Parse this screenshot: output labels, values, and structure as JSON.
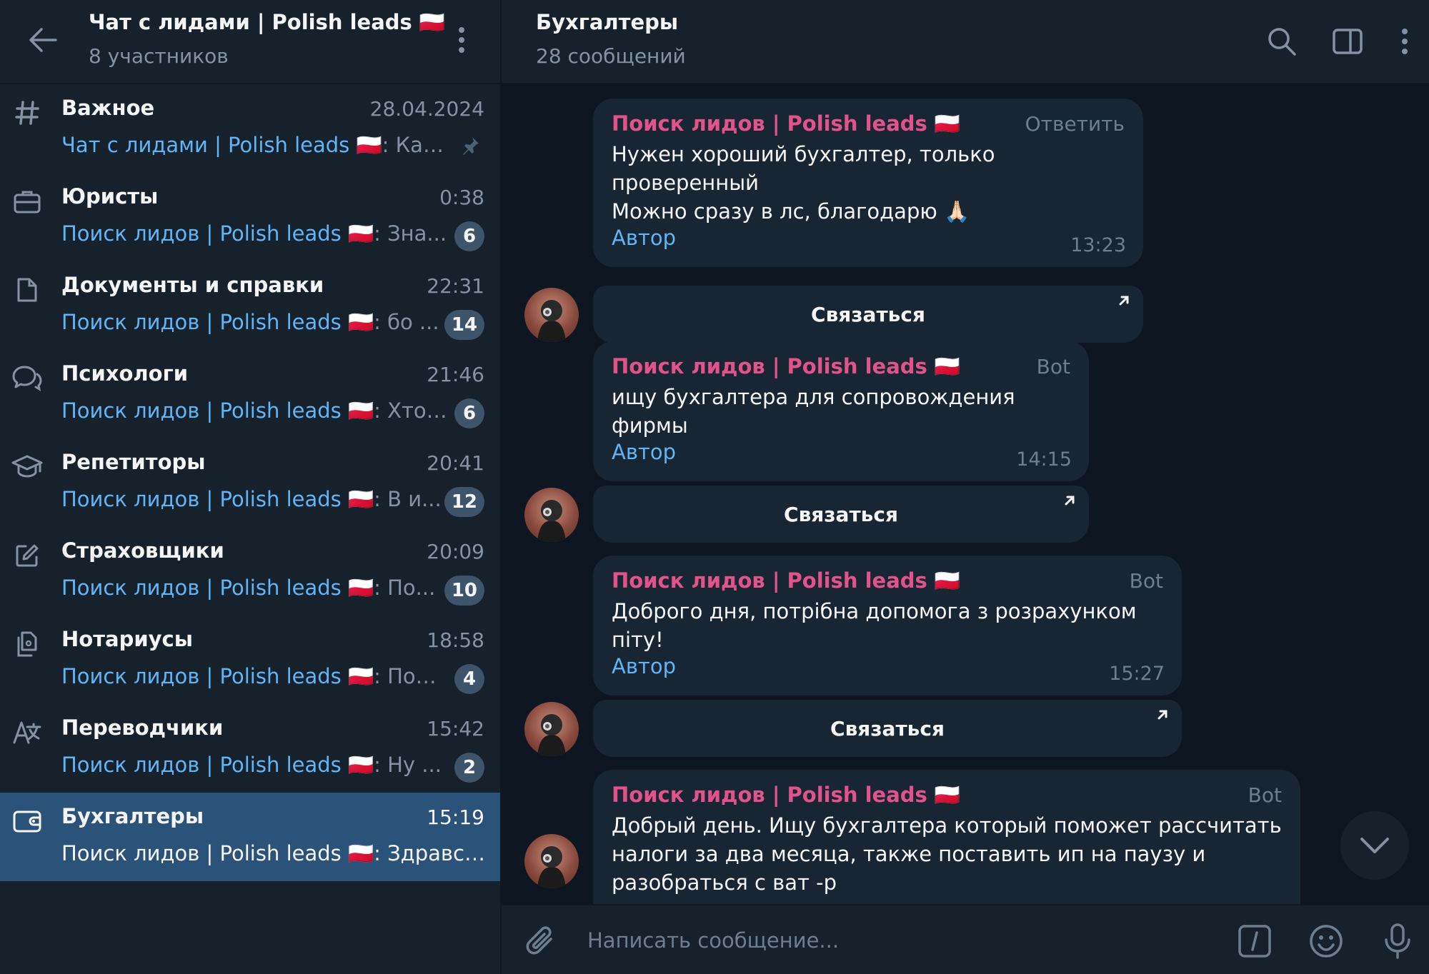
{
  "sidebar": {
    "title": "Чат с лидами | Polish leads 🇵🇱",
    "subtitle": "8 участников",
    "topics": [
      {
        "icon": "hash-icon",
        "name": "Важное",
        "time": "28.04.2024",
        "sender": "Чат с лидами | Polish leads 🇵🇱",
        "text": ": Как...",
        "badge": "",
        "pinned": true
      },
      {
        "icon": "briefcase-icon",
        "name": "Юристы",
        "time": "0:38",
        "sender": "Поиск лидов | Polish leads 🇵🇱",
        "text": ": Зна...",
        "badge": "6"
      },
      {
        "icon": "document-icon",
        "name": "Документы и справки",
        "time": "22:31",
        "sender": "Поиск лидов | Polish leads 🇵🇱",
        "text": ": бо ...",
        "badge": "14"
      },
      {
        "icon": "chat-bubbles-icon",
        "name": "Психологи",
        "time": "21:46",
        "sender": "Поиск лидов | Polish leads 🇵🇱",
        "text": ": Хто ...",
        "badge": "6"
      },
      {
        "icon": "graduation-cap-icon",
        "name": "Репетиторы",
        "time": "20:41",
        "sender": "Поиск лидов | Polish leads 🇵🇱",
        "text": ": В и...",
        "badge": "12"
      },
      {
        "icon": "edit-icon",
        "name": "Страховщики",
        "time": "20:09",
        "sender": "Поиск лидов | Polish leads 🇵🇱",
        "text": ": По...",
        "badge": "10"
      },
      {
        "icon": "copy-documents-icon",
        "name": "Нотариусы",
        "time": "18:58",
        "sender": "Поиск лидов | Polish leads 🇵🇱",
        "text": ": Под...",
        "badge": "4"
      },
      {
        "icon": "translate-icon",
        "name": "Переводчики",
        "time": "15:42",
        "sender": "Поиск лидов | Polish leads 🇵🇱",
        "text": ": Ну ...",
        "badge": "2"
      },
      {
        "icon": "wallet-icon",
        "name": "Бухгалтеры",
        "time": "15:19",
        "sender": "Поиск лидов | Polish leads 🇵🇱",
        "text": ": Здравст...",
        "badge": "",
        "active": true
      }
    ]
  },
  "chat": {
    "title": "Бухгалтеры",
    "subtitle": "28 сообщений",
    "messages": [
      {
        "sender": "Поиск лидов | Polish leads 🇵🇱",
        "tag": "Ответить",
        "text": "Нужен хороший бухгалтер, только проверенный\nМожно сразу в лс, благодарю 🙏🏻",
        "author": "Автор",
        "time": "13:23",
        "button": "Связаться"
      },
      {
        "sender": "Поиск лидов | Polish leads 🇵🇱",
        "tag": "Bot",
        "text": "ищу бухгалтера для сопровождения фирмы",
        "author": "Автор",
        "time": "14:15",
        "button": "Связаться"
      },
      {
        "sender": "Поиск лидов | Polish leads 🇵🇱",
        "tag": "Bot",
        "text": "Доброго дня, потрібна допомога з розрахунком піту!",
        "author": "Автор",
        "time": "15:27",
        "button": "Связаться"
      },
      {
        "sender": "Поиск лидов | Polish leads 🇵🇱",
        "tag": "Bot",
        "text": "Добрый день. Ищу бухгалтера который поможет рассчитать\nналоги за два месяца, также поставить ип на паузу и\nразобраться с ват -р",
        "author": "",
        "time": "",
        "button": ""
      }
    ]
  },
  "composer": {
    "placeholder": "Написать сообщение..."
  },
  "colors": {
    "sidebar_bg": "#17212b",
    "chat_bg": "#0e1621",
    "active_topic": "#2b5278",
    "sender_pink": "#e2538c",
    "link_blue": "#5eb5f7",
    "badge_bg": "#3e546a"
  }
}
